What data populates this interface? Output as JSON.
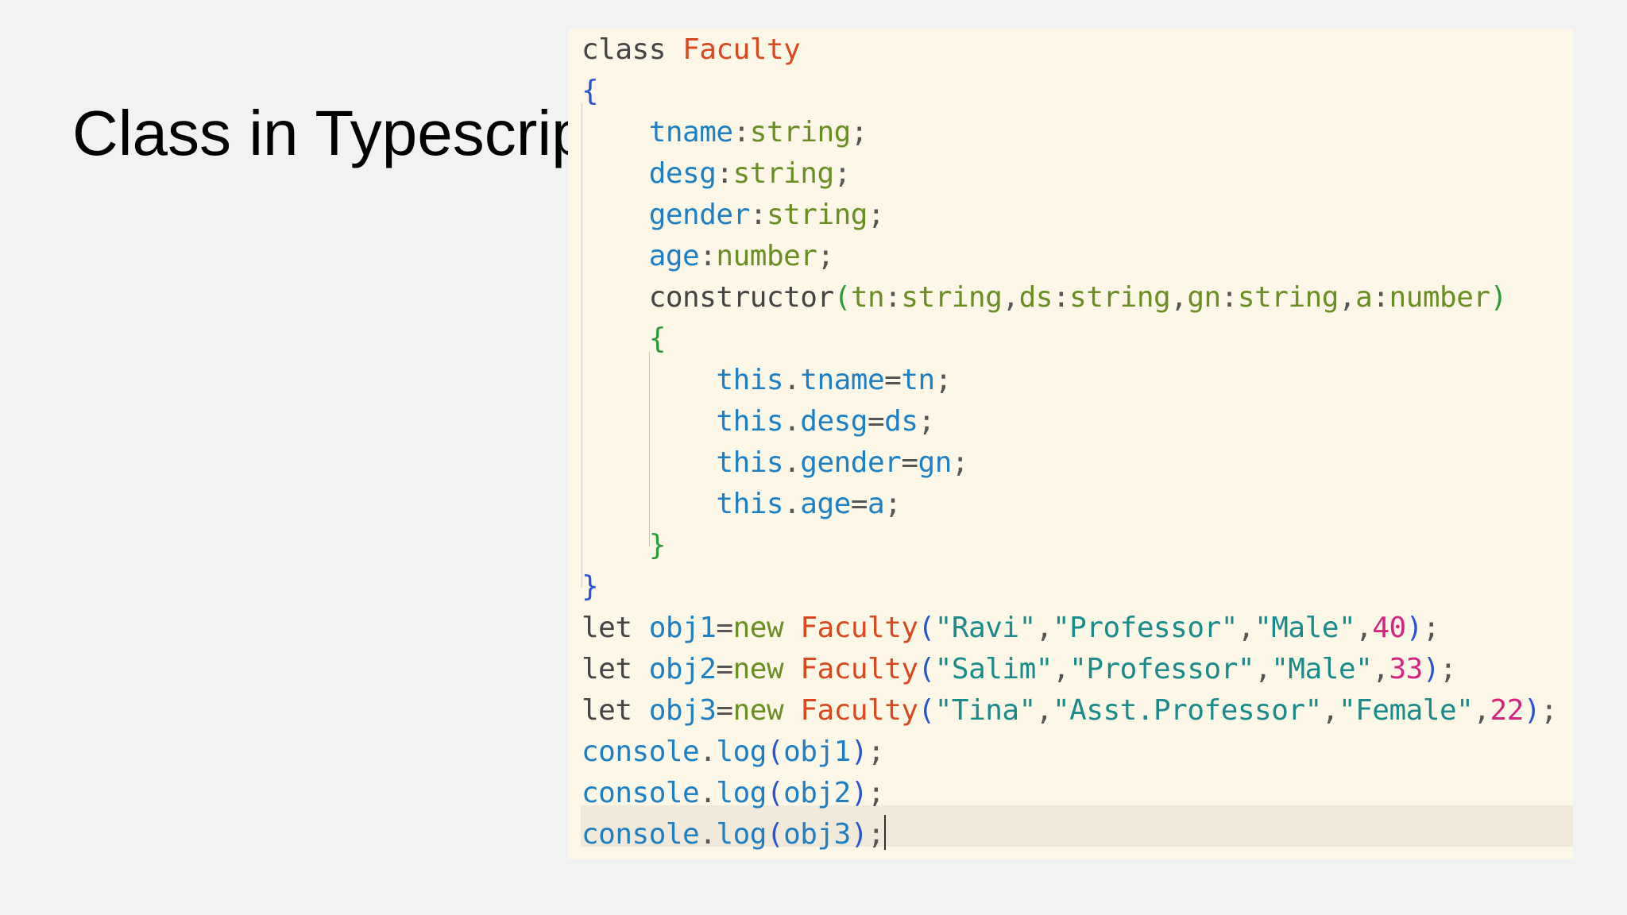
{
  "slide": {
    "title": "Class in Typescrip"
  },
  "editor": {
    "colors": {
      "background": "#fdf7e7",
      "current_line": "#f1e9d9",
      "keyword": "#444444",
      "class_name": "#d9481e",
      "property": "#1e7fc4",
      "type": "#6b8e23",
      "brace": "#2a55d0",
      "inner_brace": "#2b9a38",
      "string": "#1a8a8a",
      "number": "#d6237d",
      "punct": "#555555"
    },
    "lines": [
      [
        {
          "t": "class",
          "c": "keyword"
        },
        {
          "t": " "
        },
        {
          "t": "Faculty",
          "c": "class_name"
        }
      ],
      [
        {
          "t": "{",
          "c": "brace"
        }
      ],
      [
        {
          "t": "    "
        },
        {
          "t": "tname",
          "c": "property"
        },
        {
          "t": ":",
          "c": "punct"
        },
        {
          "t": "string",
          "c": "type"
        },
        {
          "t": ";",
          "c": "punct"
        }
      ],
      [
        {
          "t": "    "
        },
        {
          "t": "desg",
          "c": "property"
        },
        {
          "t": ":",
          "c": "punct"
        },
        {
          "t": "string",
          "c": "type"
        },
        {
          "t": ";",
          "c": "punct"
        }
      ],
      [
        {
          "t": "    "
        },
        {
          "t": "gender",
          "c": "property"
        },
        {
          "t": ":",
          "c": "punct"
        },
        {
          "t": "string",
          "c": "type"
        },
        {
          "t": ";",
          "c": "punct"
        }
      ],
      [
        {
          "t": "    "
        },
        {
          "t": "age",
          "c": "property"
        },
        {
          "t": ":",
          "c": "punct"
        },
        {
          "t": "number",
          "c": "type"
        },
        {
          "t": ";",
          "c": "punct"
        }
      ],
      [
        {
          "t": "    "
        },
        {
          "t": "constructor",
          "c": "keyword"
        },
        {
          "t": "(",
          "c": "inner_brace"
        },
        {
          "t": "tn",
          "c": "type"
        },
        {
          "t": ":",
          "c": "punct"
        },
        {
          "t": "string",
          "c": "type"
        },
        {
          "t": ",",
          "c": "punct"
        },
        {
          "t": "ds",
          "c": "type"
        },
        {
          "t": ":",
          "c": "punct"
        },
        {
          "t": "string",
          "c": "type"
        },
        {
          "t": ",",
          "c": "punct"
        },
        {
          "t": "gn",
          "c": "type"
        },
        {
          "t": ":",
          "c": "punct"
        },
        {
          "t": "string",
          "c": "type"
        },
        {
          "t": ",",
          "c": "punct"
        },
        {
          "t": "a",
          "c": "type"
        },
        {
          "t": ":",
          "c": "punct"
        },
        {
          "t": "number",
          "c": "type"
        },
        {
          "t": ")",
          "c": "inner_brace"
        }
      ],
      [
        {
          "t": "    "
        },
        {
          "t": "{",
          "c": "inner_brace"
        }
      ],
      [
        {
          "t": "        "
        },
        {
          "t": "this",
          "c": "property"
        },
        {
          "t": ".",
          "c": "punct"
        },
        {
          "t": "tname",
          "c": "property"
        },
        {
          "t": "=",
          "c": "punct"
        },
        {
          "t": "tn",
          "c": "property"
        },
        {
          "t": ";",
          "c": "punct"
        }
      ],
      [
        {
          "t": "        "
        },
        {
          "t": "this",
          "c": "property"
        },
        {
          "t": ".",
          "c": "punct"
        },
        {
          "t": "desg",
          "c": "property"
        },
        {
          "t": "=",
          "c": "punct"
        },
        {
          "t": "ds",
          "c": "property"
        },
        {
          "t": ";",
          "c": "punct"
        }
      ],
      [
        {
          "t": "        "
        },
        {
          "t": "this",
          "c": "property"
        },
        {
          "t": ".",
          "c": "punct"
        },
        {
          "t": "gender",
          "c": "property"
        },
        {
          "t": "=",
          "c": "punct"
        },
        {
          "t": "gn",
          "c": "property"
        },
        {
          "t": ";",
          "c": "punct"
        }
      ],
      [
        {
          "t": "        "
        },
        {
          "t": "this",
          "c": "property"
        },
        {
          "t": ".",
          "c": "punct"
        },
        {
          "t": "age",
          "c": "property"
        },
        {
          "t": "=",
          "c": "punct"
        },
        {
          "t": "a",
          "c": "property"
        },
        {
          "t": ";",
          "c": "punct"
        }
      ],
      [
        {
          "t": "    "
        },
        {
          "t": "}",
          "c": "inner_brace"
        }
      ],
      [
        {
          "t": "}",
          "c": "brace"
        }
      ],
      [
        {
          "t": "let",
          "c": "keyword"
        },
        {
          "t": " "
        },
        {
          "t": "obj1",
          "c": "property"
        },
        {
          "t": "=",
          "c": "punct"
        },
        {
          "t": "new",
          "c": "type"
        },
        {
          "t": " "
        },
        {
          "t": "Faculty",
          "c": "class_name"
        },
        {
          "t": "(",
          "c": "brace"
        },
        {
          "t": "\"Ravi\"",
          "c": "string"
        },
        {
          "t": ",",
          "c": "punct"
        },
        {
          "t": "\"Professor\"",
          "c": "string"
        },
        {
          "t": ",",
          "c": "punct"
        },
        {
          "t": "\"Male\"",
          "c": "string"
        },
        {
          "t": ",",
          "c": "punct"
        },
        {
          "t": "40",
          "c": "number"
        },
        {
          "t": ")",
          "c": "brace"
        },
        {
          "t": ";",
          "c": "punct"
        }
      ],
      [
        {
          "t": "let",
          "c": "keyword"
        },
        {
          "t": " "
        },
        {
          "t": "obj2",
          "c": "property"
        },
        {
          "t": "=",
          "c": "punct"
        },
        {
          "t": "new",
          "c": "type"
        },
        {
          "t": " "
        },
        {
          "t": "Faculty",
          "c": "class_name"
        },
        {
          "t": "(",
          "c": "brace"
        },
        {
          "t": "\"Salim\"",
          "c": "string"
        },
        {
          "t": ",",
          "c": "punct"
        },
        {
          "t": "\"Professor\"",
          "c": "string"
        },
        {
          "t": ",",
          "c": "punct"
        },
        {
          "t": "\"Male\"",
          "c": "string"
        },
        {
          "t": ",",
          "c": "punct"
        },
        {
          "t": "33",
          "c": "number"
        },
        {
          "t": ")",
          "c": "brace"
        },
        {
          "t": ";",
          "c": "punct"
        }
      ],
      [
        {
          "t": "let",
          "c": "keyword"
        },
        {
          "t": " "
        },
        {
          "t": "obj3",
          "c": "property"
        },
        {
          "t": "=",
          "c": "punct"
        },
        {
          "t": "new",
          "c": "type"
        },
        {
          "t": " "
        },
        {
          "t": "Faculty",
          "c": "class_name"
        },
        {
          "t": "(",
          "c": "brace"
        },
        {
          "t": "\"Tina\"",
          "c": "string"
        },
        {
          "t": ",",
          "c": "punct"
        },
        {
          "t": "\"Asst.Professor\"",
          "c": "string"
        },
        {
          "t": ",",
          "c": "punct"
        },
        {
          "t": "\"Female\"",
          "c": "string"
        },
        {
          "t": ",",
          "c": "punct"
        },
        {
          "t": "22",
          "c": "number"
        },
        {
          "t": ")",
          "c": "brace"
        },
        {
          "t": ";",
          "c": "punct"
        }
      ],
      [
        {
          "t": "console",
          "c": "property"
        },
        {
          "t": ".",
          "c": "punct"
        },
        {
          "t": "log",
          "c": "property"
        },
        {
          "t": "(",
          "c": "brace"
        },
        {
          "t": "obj1",
          "c": "property"
        },
        {
          "t": ")",
          "c": "brace"
        },
        {
          "t": ";",
          "c": "punct"
        }
      ],
      [
        {
          "t": "console",
          "c": "property"
        },
        {
          "t": ".",
          "c": "punct"
        },
        {
          "t": "log",
          "c": "property"
        },
        {
          "t": "(",
          "c": "brace"
        },
        {
          "t": "obj2",
          "c": "property"
        },
        {
          "t": ")",
          "c": "brace"
        },
        {
          "t": ";",
          "c": "punct"
        }
      ],
      [
        {
          "t": "console",
          "c": "property"
        },
        {
          "t": ".",
          "c": "punct"
        },
        {
          "t": "log",
          "c": "property"
        },
        {
          "t": "(",
          "c": "brace"
        },
        {
          "t": "obj3",
          "c": "property"
        },
        {
          "t": ")",
          "c": "brace"
        },
        {
          "t": ";",
          "c": "punct"
        }
      ]
    ]
  }
}
